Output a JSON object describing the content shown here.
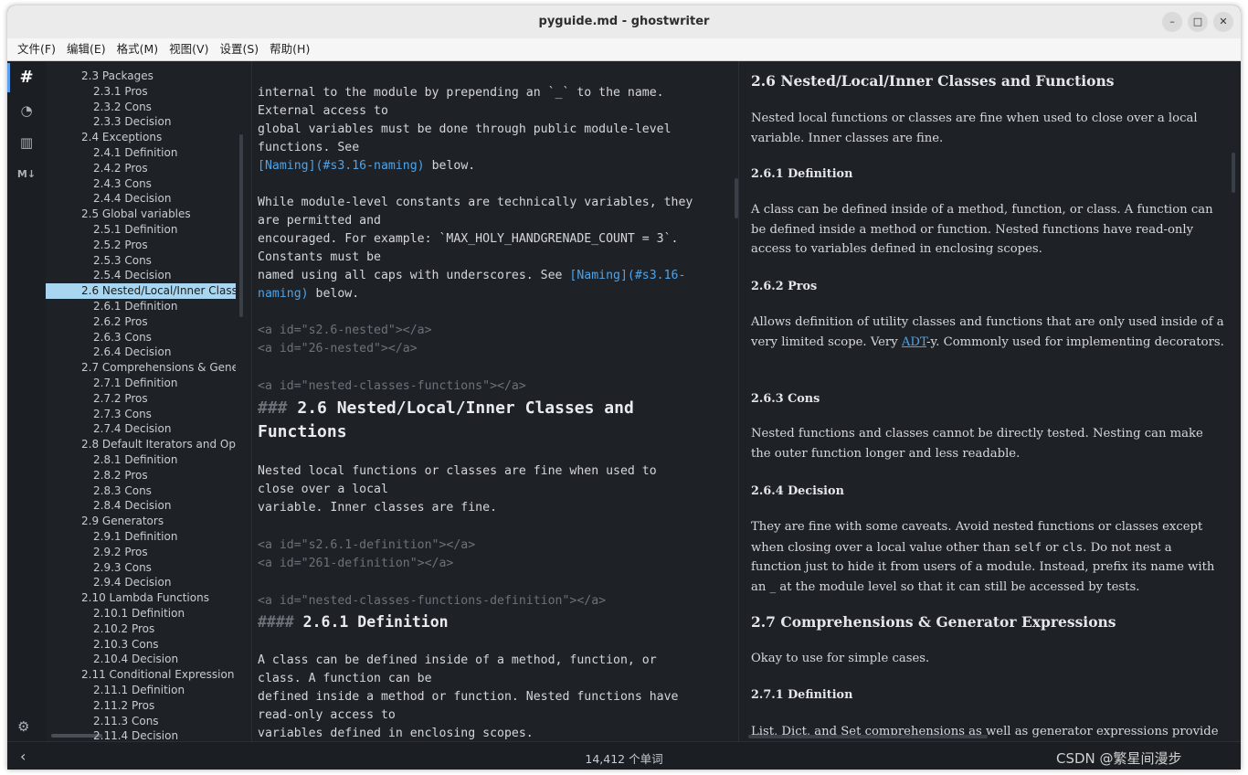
{
  "window": {
    "title": "pyguide.md - ghostwriter",
    "min": "–",
    "max": "□",
    "close": "✕"
  },
  "menu": [
    "文件(F)",
    "编辑(E)",
    "格式(M)",
    "视图(V)",
    "设置(S)",
    "帮助(H)"
  ],
  "iconbar": {
    "outline": "#",
    "stats": "◔",
    "doc_stats": "▥",
    "md": "M↓",
    "settings": "⚙"
  },
  "outline": [
    {
      "text": "2.3 Packages",
      "level": 1
    },
    {
      "text": "2.3.1 Pros",
      "level": 2
    },
    {
      "text": "2.3.2 Cons",
      "level": 2
    },
    {
      "text": "2.3.3 Decision",
      "level": 2
    },
    {
      "text": "2.4 Exceptions",
      "level": 1
    },
    {
      "text": "2.4.1 Definition",
      "level": 2
    },
    {
      "text": "2.4.2 Pros",
      "level": 2
    },
    {
      "text": "2.4.3 Cons",
      "level": 2
    },
    {
      "text": "2.4.4 Decision",
      "level": 2
    },
    {
      "text": "2.5 Global variables",
      "level": 1
    },
    {
      "text": "2.5.1 Definition",
      "level": 2
    },
    {
      "text": "2.5.2 Pros",
      "level": 2
    },
    {
      "text": "2.5.3 Cons",
      "level": 2
    },
    {
      "text": "2.5.4 Decision",
      "level": 2
    },
    {
      "text": "2.6 Nested/Local/Inner Class",
      "level": 1,
      "selected": true
    },
    {
      "text": "2.6.1 Definition",
      "level": 2
    },
    {
      "text": "2.6.2 Pros",
      "level": 2
    },
    {
      "text": "2.6.3 Cons",
      "level": 2
    },
    {
      "text": "2.6.4 Decision",
      "level": 2
    },
    {
      "text": "2.7 Comprehensions & Gene",
      "level": 1
    },
    {
      "text": "2.7.1 Definition",
      "level": 2
    },
    {
      "text": "2.7.2 Pros",
      "level": 2
    },
    {
      "text": "2.7.3 Cons",
      "level": 2
    },
    {
      "text": "2.7.4 Decision",
      "level": 2
    },
    {
      "text": "2.8 Default Iterators and Op",
      "level": 1
    },
    {
      "text": "2.8.1 Definition",
      "level": 2
    },
    {
      "text": "2.8.2 Pros",
      "level": 2
    },
    {
      "text": "2.8.3 Cons",
      "level": 2
    },
    {
      "text": "2.8.4 Decision",
      "level": 2
    },
    {
      "text": "2.9 Generators",
      "level": 1
    },
    {
      "text": "2.9.1 Definition",
      "level": 2
    },
    {
      "text": "2.9.2 Pros",
      "level": 2
    },
    {
      "text": "2.9.3 Cons",
      "level": 2
    },
    {
      "text": "2.9.4 Decision",
      "level": 2
    },
    {
      "text": "2.10 Lambda Functions",
      "level": 1
    },
    {
      "text": "2.10.1 Definition",
      "level": 2
    },
    {
      "text": "2.10.2 Pros",
      "level": 2
    },
    {
      "text": "2.10.3 Cons",
      "level": 2
    },
    {
      "text": "2.10.4 Decision",
      "level": 2
    },
    {
      "text": "2.11 Conditional Expression",
      "level": 1
    },
    {
      "text": "2.11.1 Definition",
      "level": 2
    },
    {
      "text": "2.11.2 Pros",
      "level": 2
    },
    {
      "text": "2.11.3 Cons",
      "level": 2
    },
    {
      "text": "2.11.4 Decision",
      "level": 2
    }
  ],
  "editor": {
    "e1a": "internal to the module by prepending an `_` to the name.",
    "e1b": "External access to",
    "e2a": "global variables must be done through public module-level",
    "e2b": "functions. See",
    "e3link": "[Naming](#s3.16-naming)",
    "e3rest": " below.",
    "e4a": "While module-level constants are technically variables, they",
    "e4b": "are permitted and",
    "e5a": "encouraged. For example: `MAX_HOLY_HANDGRENADE_COUNT = 3`.",
    "e5b": "Constants must be",
    "e6a": "named using all caps with underscores. See ",
    "e6link": "[Naming](#s3.16-",
    "e6c": "naming)",
    "e6rest": " below.",
    "a1": "<a id=\"s2.6-nested\"></a>",
    "a2": "<a id=\"26-nested\"></a>",
    "a3": "<a id=\"nested-classes-functions\"></a>",
    "h3mark": "### ",
    "h3a": "2.6 Nested/Local/Inner Classes and",
    "h3b": "Functions",
    "p1a": "Nested local functions or classes are fine when used to",
    "p1b": "close over a local",
    "p1c": "variable. Inner classes are fine.",
    "a4": "<a id=\"s2.6.1-definition\"></a>",
    "a5": "<a id=\"261-definition\"></a>",
    "a6": "<a id=\"nested-classes-functions-definition\"></a>",
    "h4mark": "#### ",
    "h4": "2.6.1 Definition",
    "p2a": "A class can be defined inside of a method, function, or",
    "p2b": "class. A function can be",
    "p2c": "defined inside a method or function. Nested functions have",
    "p2d": "read-only access to",
    "p2e": "variables defined in enclosing scopes."
  },
  "preview": {
    "h26": "2.6 Nested/Local/Inner Classes and Functions",
    "p26": "Nested local functions or classes are fine when used to close over a local variable. Inner classes are fine.",
    "h261": "2.6.1 Definition",
    "p261": "A class can be defined inside of a method, function, or class. A function can be defined inside a method or function. Nested functions have read-only access to variables defined in enclosing scopes.",
    "h262": "2.6.2 Pros",
    "p262a": "Allows definition of utility classes and functions that are only used inside of a very limited scope. Very ",
    "p262link": "ADT",
    "p262b": "-y. Commonly used for implementing decorators.",
    "h263": "2.6.3 Cons",
    "p263": "Nested functions and classes cannot be directly tested. Nesting can make the outer function longer and less readable.",
    "h264": "2.6.4 Decision",
    "p264a": "They are fine with some caveats. Avoid nested functions or classes except when closing over a local value other than ",
    "p264c1": "self",
    "p264or": " or ",
    "p264c2": "cls",
    "p264b": ". Do not nest a function just to hide it from users of a module. Instead, prefix its name with an _ at the module level so that it can still be accessed by tests.",
    "h27": "2.7 Comprehensions & Generator Expressions",
    "p27": "Okay to use for simple cases.",
    "h271": "2.7.1 Definition",
    "p271": "List, Dict, and Set comprehensions as well as generator expressions provide"
  },
  "status": {
    "words": "14,412 个单词",
    "watermark": "CSDN @繁星间漫步"
  }
}
